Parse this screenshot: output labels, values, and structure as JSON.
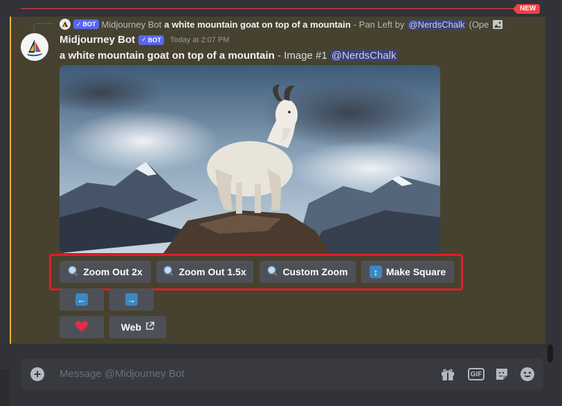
{
  "new_badge": "NEW",
  "reply": {
    "bot_tag": "BOT",
    "author": "Midjourney Bot",
    "prompt": "a white mountain goat on top of a mountain",
    "action_text": "- Pan Left by",
    "mention": "@NerdsChalk",
    "suffix": "(Ope"
  },
  "message": {
    "author": "Midjourney Bot",
    "bot_tag": "BOT",
    "timestamp": "Today at 2:07 PM",
    "prompt": "a white mountain goat on top of a mountain",
    "image_label": "- Image #1",
    "mention": "@NerdsChalk"
  },
  "buttons": {
    "zoom_out_2x": "Zoom Out 2x",
    "zoom_out_15x": "Zoom Out 1.5x",
    "custom_zoom": "Custom Zoom",
    "make_square": "Make Square",
    "web": "Web"
  },
  "composer": {
    "placeholder": "Message @Midjourney Bot",
    "gif_label": "GIF"
  },
  "colors": {
    "accent_blurple": "#5865f2",
    "highlight_red": "#e11d2b",
    "message_highlight": "#46422f",
    "new_red": "#f23f43"
  },
  "icons": [
    "magnifier-icon",
    "arrows-vertical-icon",
    "arrow-left-icon",
    "arrow-right-icon",
    "heart-icon",
    "external-link-icon",
    "plus-icon",
    "gift-icon",
    "gif-icon",
    "sticker-icon",
    "emoji-icon",
    "image-icon"
  ]
}
